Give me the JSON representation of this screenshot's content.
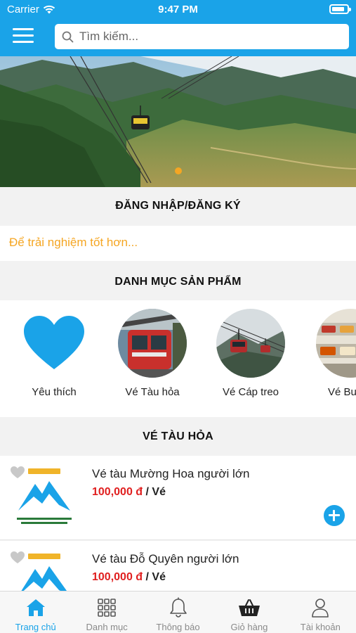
{
  "status_bar": {
    "carrier": "Carrier",
    "time": "9:47 PM"
  },
  "search": {
    "placeholder": "Tìm kiếm..."
  },
  "login": {
    "heading": "ĐĂNG NHẬP/ĐĂNG KÝ",
    "note": "Để trải nghiệm tốt hơn..."
  },
  "categories": {
    "heading": "DANH MỤC SẢN PHẨM",
    "items": [
      {
        "label": "Yêu thích",
        "icon": "heart-icon"
      },
      {
        "label": "Vé Tàu hỏa",
        "icon": "train-photo"
      },
      {
        "label": "Vé Cáp treo",
        "icon": "cable-car-photo"
      },
      {
        "label": "Vé Bu",
        "icon": "buffet-photo"
      }
    ]
  },
  "products": {
    "heading": "VÉ TÀU HỎA",
    "items": [
      {
        "name": "Vé tàu Mường Hoa người lớn",
        "price": "100,000 đ",
        "unit": "/ Vé"
      },
      {
        "name": "Vé tàu Đỗ Quyên người lớn",
        "price": "100,000 đ",
        "unit": "/ Vé"
      }
    ]
  },
  "tabs": [
    {
      "label": "Trang chủ",
      "icon": "home-icon",
      "active": true
    },
    {
      "label": "Danh mục",
      "icon": "grid-icon",
      "active": false
    },
    {
      "label": "Thông báo",
      "icon": "bell-icon",
      "active": false
    },
    {
      "label": "Giỏ hàng",
      "icon": "basket-icon",
      "active": false
    },
    {
      "label": "Tài khoản",
      "icon": "user-icon",
      "active": false
    }
  ],
  "colors": {
    "primary": "#1aa3e8",
    "accent": "#f5a623",
    "price": "#e02020"
  }
}
